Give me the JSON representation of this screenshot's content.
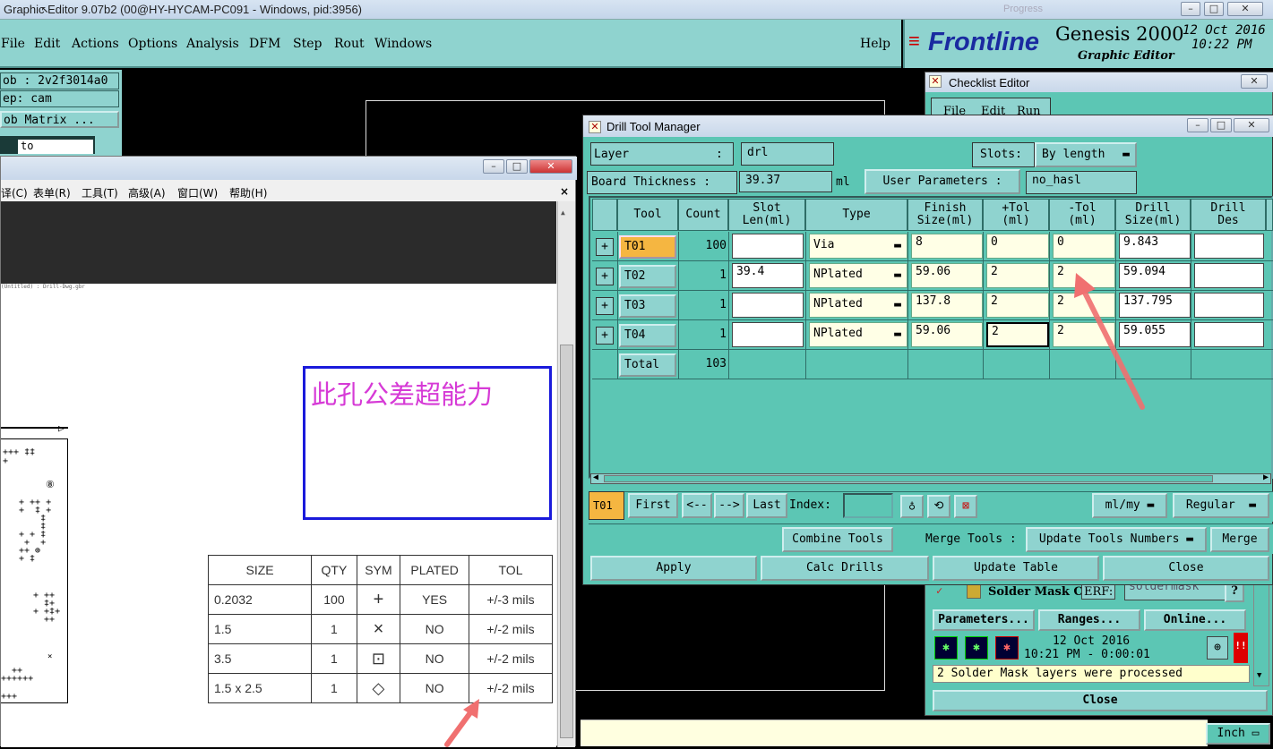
{
  "titlebar": {
    "title": "Graphic Editor 9.07b2 (00@HY-HYCAM-PC091 - Windows, pid:3956)",
    "ghost": "Progress"
  },
  "menu": {
    "items": [
      "File",
      "Edit",
      "Actions",
      "Options",
      "Analysis",
      "DFM",
      "Step",
      "Rout",
      "Windows"
    ],
    "help": "Help"
  },
  "brand": {
    "logo": "Frontline",
    "product": "Genesis 2000",
    "sub": "Graphic Editor",
    "date": "12 Oct 2016",
    "time": "10:22 PM"
  },
  "left": {
    "job": "ob : 2v2f3014a0",
    "step": "ep: cam",
    "matrix": "ob Matrix ...",
    "to": "to"
  },
  "cnwin": {
    "menu": [
      "译(C)",
      "表单(R)",
      "工具(T)",
      "高级(A)",
      "窗口(W)",
      "帮助(H)"
    ],
    "filename": "(Untitled) : Drill-Dwg.gbr",
    "note": "此孔公差超能力",
    "table": {
      "headers": [
        "SIZE",
        "QTY",
        "SYM",
        "PLATED",
        "TOL"
      ],
      "rows": [
        [
          "0.2032",
          "100",
          "+",
          "YES",
          "+/-3 mils"
        ],
        [
          "1.5",
          "1",
          "×",
          "NO",
          "+/-2 mils"
        ],
        [
          "3.5",
          "1",
          "⊡",
          "NO",
          "+/-2 mils"
        ],
        [
          "1.5 x 2.5",
          "1",
          "◇",
          "NO",
          "+/-2 mils"
        ]
      ]
    }
  },
  "checklist": {
    "title": "Checklist Editor",
    "menu": [
      "File",
      "Edit",
      "Run"
    ],
    "item": "Solder Mask Ch",
    "erf_label": "ERF:",
    "erf_value": "soldermask",
    "q": "?",
    "buttons": [
      "Parameters...",
      "Ranges...",
      "Online..."
    ],
    "date": "12 Oct 2016",
    "time": "10:21 PM - 0:00:01",
    "status": "2 Solder Mask layers were processed",
    "close": "Close",
    "bang": "!!"
  },
  "dtm": {
    "title": "Drill Tool Manager",
    "layer_label": "Layer",
    "layer_colon": ":",
    "layer_value": "drl",
    "slots_label": "Slots:",
    "slots_value": "By length",
    "thick_label": "Board Thickness :",
    "thick_value": "39.37",
    "thick_unit": "ml",
    "userparam_label": "User Parameters :",
    "userparam_value": "no_hasl",
    "headers": [
      "Tool",
      "Count",
      "Slot\nLen(ml)",
      "Type",
      "Finish\nSize(ml)",
      "+Tol\n(ml)",
      "-Tol\n(ml)",
      "Drill\nSize(ml)",
      "Drill\nDes"
    ],
    "rows": [
      {
        "tool": "T01",
        "count": "100",
        "slot": "",
        "type": "Via",
        "finish": "8",
        "ptol": "0",
        "mtol": "0",
        "drill": "9.843",
        "des": ""
      },
      {
        "tool": "T02",
        "count": "1",
        "slot": "39.4",
        "type": "NPlated",
        "finish": "59.06",
        "ptol": "2",
        "mtol": "2",
        "drill": "59.094",
        "des": ""
      },
      {
        "tool": "T03",
        "count": "1",
        "slot": "",
        "type": "NPlated",
        "finish": "137.8",
        "ptol": "2",
        "mtol": "2",
        "drill": "137.795",
        "des": ""
      },
      {
        "tool": "T04",
        "count": "1",
        "slot": "",
        "type": "NPlated",
        "finish": "59.06",
        "ptol": "2",
        "mtol": "2",
        "drill": "59.055",
        "des": ""
      }
    ],
    "total_label": "Total",
    "total_count": "103",
    "nav": {
      "current": "T01",
      "first": "First",
      "prev": "<--",
      "next": "-->",
      "last": "Last",
      "index": "Index:",
      "unit": "ml/my",
      "mode": "Regular"
    },
    "row2": {
      "combine": "Combine Tools",
      "merge_label": "Merge Tools :",
      "update_nums": "Update Tools Numbers",
      "merge": "Merge"
    },
    "row3": {
      "apply": "Apply",
      "calc": "Calc Drills",
      "update": "Update Table",
      "close": "Close"
    }
  },
  "bottom": {
    "inch": "Inch"
  }
}
